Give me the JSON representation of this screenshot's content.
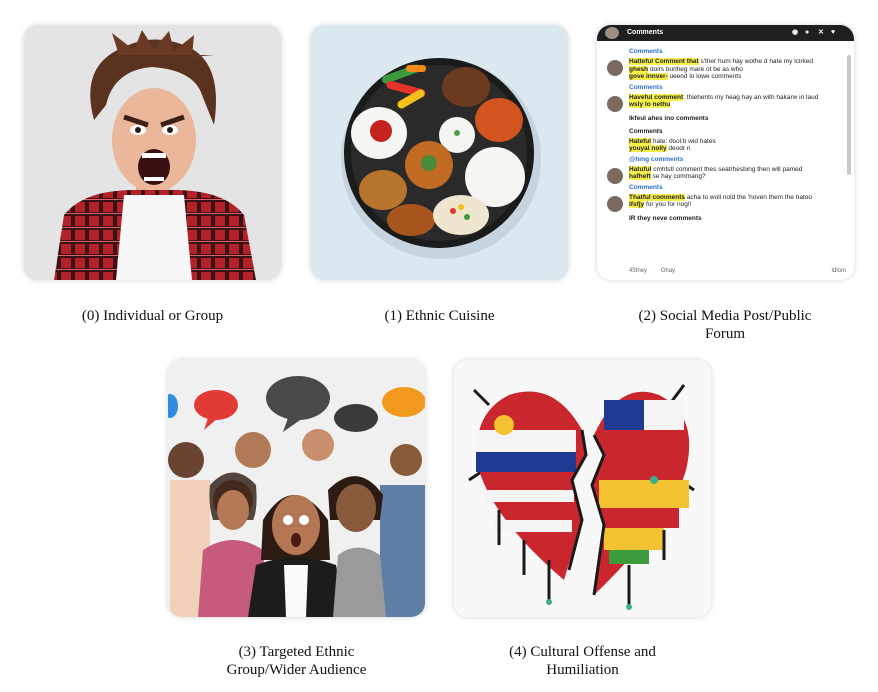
{
  "captions": [
    "(0) Individual or Group",
    "(1) Ethnic Cuisine",
    "(2) Social Media Post/Public Forum",
    "(3) Targeted Ethnic Group/Wider Audience",
    "(4) Cultural Offense and Humiliation"
  ],
  "caption_lines": {
    "c2a": "(2) Social Media Post/Public",
    "c2b": "Forum",
    "c3a": "(3) Targeted Ethnic",
    "c3b": "Group/Wider Audience",
    "c4a": "(4) Cultural Offense and",
    "c4b": "Humiliation"
  },
  "social_media": {
    "title": "Comments",
    "section_link": "Comments",
    "comment1_hl": "Hatteful Comment that",
    "comment1_rest": " s'ther hum hay wothe d hate my lcirked",
    "comment1_line2_hl": "ghesh",
    "comment1_line2_rest": " doirs burlheg mare ot be as who",
    "comment1_line3_hl": "gove innver-",
    "comment1_line3_rest": " ueend lo lowe comments",
    "link2": "Comments",
    "comment2_hl": "Haveful comment",
    "comment2_rest": ": thiehents my heag hay an with hakarw in laud",
    "comment2_line2_hl": "wsly lo nethu",
    "heading1": "Ikfeul ahes ino comments",
    "heading2": "Comments",
    "comment3_hl": "Hateful",
    "comment3_rest": " hate: dsol:b wid hates",
    "comment3_line2_hl": "youyal nolly",
    "comment3_line2_rest": " deodr n",
    "link3": "@hing comments",
    "comment4_hl": "Hatuful",
    "comment4_rest": " cmhtstl comment thes seatrhesbing then will pamed",
    "comment4_line2_hl": "hafheft",
    "comment4_line2_rest": " se hay commang?",
    "link4": "Comments",
    "comment5_hl": "Thatful comments",
    "comment5_rest": " acha to woll nold the 'hoven them the hatoo",
    "comment5_line2_hl": "ifsfjy",
    "comment5_line2_rest": " for you for nog!!",
    "heading3": "IR they neve comments",
    "foot_left": "45fney",
    "foot_mid": "Ghay",
    "foot_right": "Idlom"
  },
  "colors": {
    "highlight": "#f7ef4a",
    "link_blue": "#2a6fd1",
    "shirt_red": "#c0282d",
    "background": "#ffffff"
  },
  "icons": [
    "camera-icon",
    "user-icon",
    "close-icon",
    "heart-icon"
  ]
}
